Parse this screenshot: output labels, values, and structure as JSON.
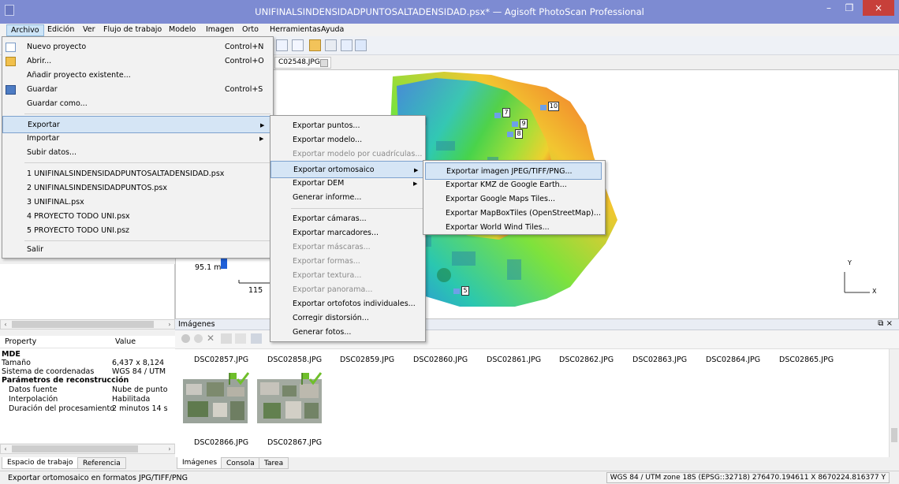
{
  "window": {
    "title": "UNIFINALSINDENSIDADPUNTOSALTADENSIDAD.psx* — Agisoft PhotoScan Professional",
    "min": "–",
    "max": "❐",
    "close": "×"
  },
  "menubar": [
    "Archivo",
    "Edición",
    "Ver",
    "Flujo de trabajo",
    "Modelo",
    "Imagen",
    "Orto",
    "Herramientas",
    "Ayuda"
  ],
  "document_tab": "C02548.JPG",
  "archivo_menu": {
    "items": [
      {
        "label": "Nuevo proyecto",
        "shortcut": "Control+N",
        "icon": "new-document-icon"
      },
      {
        "label": "Abrir...",
        "shortcut": "Control+O",
        "icon": "folder-open-icon"
      },
      {
        "label": "Añadir proyecto existente...",
        "shortcut": ""
      },
      {
        "label": "Guardar",
        "shortcut": "Control+S",
        "icon": "save-icon"
      },
      {
        "label": "Guardar como...",
        "shortcut": ""
      },
      {
        "label": "Exportar",
        "submenu": true,
        "highlighted": true
      },
      {
        "label": "Importar",
        "submenu": true
      },
      {
        "label": "Subir datos...",
        "shortcut": ""
      },
      {
        "label": "1 UNIFINALSINDENSIDADPUNTOSALTADENSIDAD.psx"
      },
      {
        "label": "2 UNIFINALSINDENSIDADPUNTOS.psx"
      },
      {
        "label": "3 UNIFINAL.psx"
      },
      {
        "label": "4 PROYECTO TODO UNI.psx"
      },
      {
        "label": "5 PROYECTO TODO UNI.psz"
      },
      {
        "label": "Salir"
      }
    ]
  },
  "exportar_menu": {
    "items": [
      {
        "label": "Exportar puntos..."
      },
      {
        "label": "Exportar modelo..."
      },
      {
        "label": "Exportar modelo por cuadrículas...",
        "disabled": true
      },
      {
        "label": "Exportar ortomosaico",
        "submenu": true,
        "highlighted": true
      },
      {
        "label": "Exportar DEM",
        "submenu": true
      },
      {
        "label": "Generar informe..."
      },
      {
        "label": "Exportar cámaras..."
      },
      {
        "label": "Exportar marcadores..."
      },
      {
        "label": "Exportar máscaras...",
        "disabled": true
      },
      {
        "label": "Exportar formas...",
        "disabled": true
      },
      {
        "label": "Exportar textura...",
        "disabled": true
      },
      {
        "label": "Exportar panorama...",
        "disabled": true
      },
      {
        "label": "Exportar ortofotos individuales..."
      },
      {
        "label": "Corregir distorsión..."
      },
      {
        "label": "Generar fotos..."
      }
    ]
  },
  "ortomosaico_menu": {
    "items": [
      {
        "label": "Exportar imagen JPEG/TIFF/PNG...",
        "highlighted": true
      },
      {
        "label": "Exportar KMZ de Google Earth..."
      },
      {
        "label": "Exportar Google Maps Tiles..."
      },
      {
        "label": "Exportar MapBoxTiles (OpenStreetMap)..."
      },
      {
        "label": "Exportar World Wind Tiles..."
      }
    ]
  },
  "workspace": {
    "legend_value": "95.1 m",
    "scale_label": "115",
    "axis_y": "Y",
    "axis_x": "X",
    "markers": [
      "7",
      "10",
      "9",
      "8",
      "5"
    ]
  },
  "properties": {
    "header_property": "Property",
    "header_value": "Value",
    "rows": [
      {
        "key": "MDE",
        "value": "",
        "style": "bold"
      },
      {
        "key": "Tamaño",
        "value": "6,437 x 8,124",
        "style": "top"
      },
      {
        "key": "Sistema de coordenadas",
        "value": "WGS 84 / UTM",
        "style": "top"
      },
      {
        "key": "Parámetros de reconstrucción",
        "value": "",
        "style": "bold"
      },
      {
        "key": "Datos fuente",
        "value": "Nube de punto",
        "style": "sub"
      },
      {
        "key": "Interpolación",
        "value": "Habilitada",
        "style": "sub"
      },
      {
        "key": "Duración del procesamiento",
        "value": "2 minutos 14 s",
        "style": "sub"
      }
    ]
  },
  "left_tabs": [
    "Espacio de trabajo",
    "Referencia"
  ],
  "images_panel": {
    "title": "Imágenes",
    "row1": [
      "DSC02857.JPG",
      "DSC02858.JPG",
      "DSC02859.JPG",
      "DSC02860.JPG",
      "DSC02861.JPG",
      "DSC02862.JPG",
      "DSC02863.JPG",
      "DSC02864.JPG",
      "DSC02865.JPG"
    ],
    "row2": [
      "DSC02866.JPG",
      "DSC02867.JPG"
    ]
  },
  "bottom_tabs": [
    "Imágenes",
    "Consola",
    "Tarea"
  ],
  "statusbar": {
    "message": "Exportar ortomosaico en formatos JPG/TIFF/PNG",
    "coords": "WGS 84 / UTM zone 18S (EPSG::32718)  276470.194611 X  8670224.816377 Y"
  },
  "colors": {
    "titlebar": "#7d8bd2",
    "menu_highlight": "#d5e5f5",
    "close_button": "#c7403a"
  }
}
